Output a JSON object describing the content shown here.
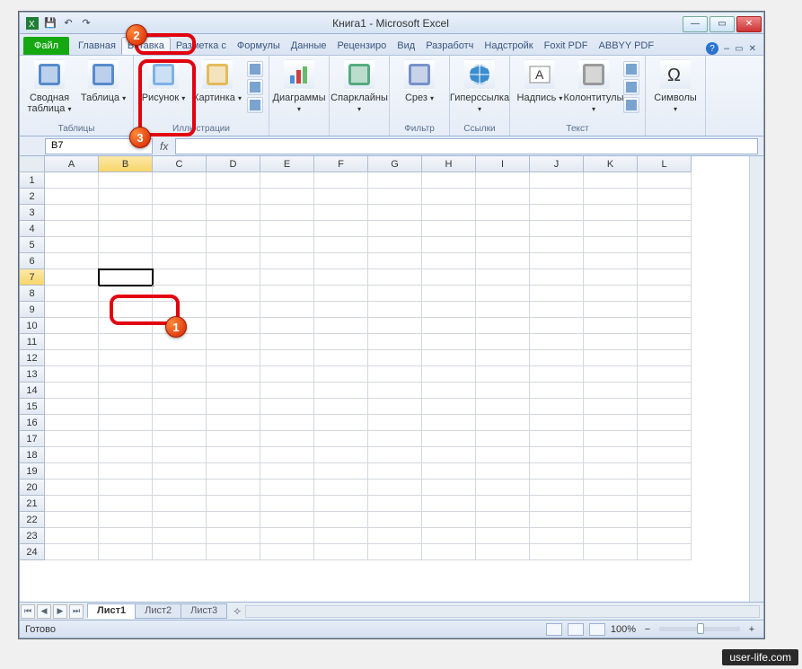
{
  "window": {
    "title": "Книга1 - Microsoft Excel",
    "qat": {
      "save": "💾",
      "undo": "↶",
      "redo": "↷"
    },
    "controls": {
      "min": "—",
      "max": "▭",
      "close": "✕"
    }
  },
  "tabs": {
    "file": "Файл",
    "items": [
      "Главная",
      "Вставка",
      "Разметка с",
      "Формулы",
      "Данные",
      "Рецензиро",
      "Вид",
      "Разработч",
      "Надстройк",
      "Foxit PDF",
      "ABBYY PDF"
    ],
    "active_index": 1,
    "help": "?"
  },
  "ribbon": {
    "groups": [
      {
        "label": "Таблицы",
        "big": [
          {
            "name": "pivot-table",
            "label": "Сводная\nтаблица"
          },
          {
            "name": "table",
            "label": "Таблица"
          }
        ]
      },
      {
        "label": "Иллюстрации",
        "big": [
          {
            "name": "picture",
            "label": "Рисунок"
          },
          {
            "name": "clipart",
            "label": "Картинка"
          }
        ],
        "small": [
          "shapes",
          "smartart",
          "screenshot"
        ]
      },
      {
        "label": "",
        "big": [
          {
            "name": "charts",
            "label": "Диаграммы"
          }
        ]
      },
      {
        "label": "",
        "big": [
          {
            "name": "sparklines",
            "label": "Спарклайны"
          }
        ]
      },
      {
        "label": "Фильтр",
        "big": [
          {
            "name": "slicer",
            "label": "Срез"
          }
        ]
      },
      {
        "label": "Ссылки",
        "big": [
          {
            "name": "hyperlink",
            "label": "Гиперссылка"
          }
        ]
      },
      {
        "label": "Текст",
        "big": [
          {
            "name": "textbox",
            "label": "Надпись"
          },
          {
            "name": "headerfooter",
            "label": "Колонтитулы"
          }
        ],
        "small": [
          "wordart",
          "sigline",
          "object"
        ]
      },
      {
        "label": "",
        "big": [
          {
            "name": "symbols",
            "label": "Символы"
          }
        ]
      }
    ]
  },
  "namebox": {
    "value": "B7",
    "fx": "fx"
  },
  "columns": [
    "A",
    "B",
    "C",
    "D",
    "E",
    "F",
    "G",
    "H",
    "I",
    "J",
    "K",
    "L"
  ],
  "rows_count": 24,
  "active_cell": {
    "col": 1,
    "row": 6
  },
  "sheet_tabs": {
    "items": [
      "Лист1",
      "Лист2",
      "Лист3"
    ],
    "active": 0
  },
  "status": {
    "ready": "Готово",
    "zoom": "100%"
  },
  "annotations": {
    "1": "1",
    "2": "2",
    "3": "3"
  },
  "watermark": "user-life.com"
}
